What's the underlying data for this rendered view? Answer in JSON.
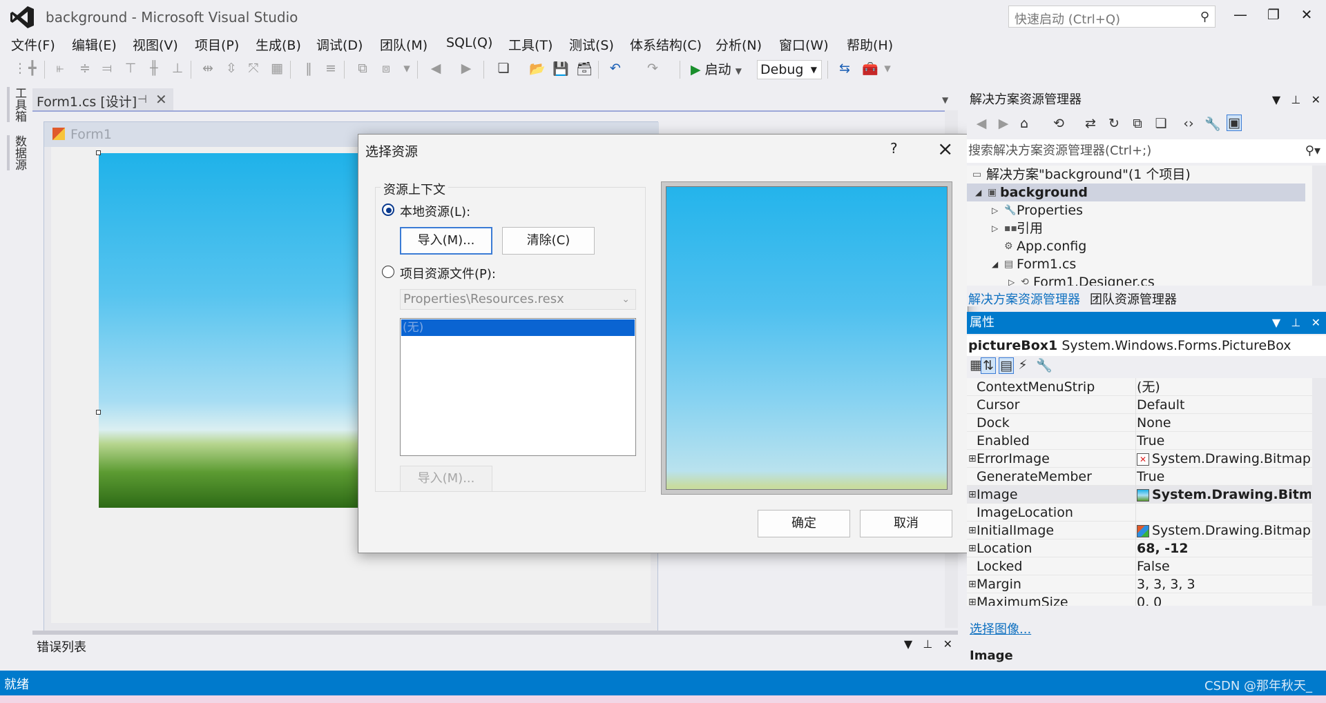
{
  "window": {
    "title": "background - Microsoft Visual Studio",
    "quick_launch_placeholder": "快速启动 (Ctrl+Q)"
  },
  "menu": [
    "文件(F)",
    "编辑(E)",
    "视图(V)",
    "项目(P)",
    "生成(B)",
    "调试(D)",
    "团队(M)",
    "SQL(Q)",
    "工具(T)",
    "测试(S)",
    "体系结构(C)",
    "分析(N)",
    "窗口(W)",
    "帮助(H)"
  ],
  "toolbar": {
    "start_label": "启动",
    "config_value": "Debug"
  },
  "side_tabs": [
    "工具箱",
    "数据源"
  ],
  "doc_tab": {
    "label": "Form1.cs [设计]"
  },
  "form": {
    "title": "Form1"
  },
  "dialog": {
    "title": "选择资源",
    "help": "?",
    "group_label": "资源上下文",
    "local_label": "本地资源(L):",
    "import_label": "导入(M)...",
    "clear_label": "清除(C)",
    "project_label": "项目资源文件(P):",
    "resx_value": "Properties\\Resources.resx",
    "list_item": "(无)",
    "import2_label": "导入(M)...",
    "ok_label": "确定",
    "cancel_label": "取消"
  },
  "solution_explorer": {
    "title": "解决方案资源管理器",
    "search_placeholder": "搜索解决方案资源管理器(Ctrl+;)",
    "tree": [
      {
        "label": "解决方案\"background\"(1 个项目)"
      },
      {
        "label": "background"
      },
      {
        "label": "Properties"
      },
      {
        "label": "引用"
      },
      {
        "label": "App.config"
      },
      {
        "label": "Form1.cs"
      },
      {
        "label": "Form1.Designer.cs"
      }
    ],
    "tabs": [
      "解决方案资源管理器",
      "团队资源管理器"
    ]
  },
  "properties": {
    "title": "属性",
    "object_name": "pictureBox1",
    "object_type": "System.Windows.Forms.PictureBox",
    "rows": [
      {
        "name": "ContextMenuStrip",
        "value": "(无)"
      },
      {
        "name": "Cursor",
        "value": "Default"
      },
      {
        "name": "Dock",
        "value": "None"
      },
      {
        "name": "Enabled",
        "value": "True"
      },
      {
        "name": "ErrorImage",
        "value": "System.Drawing.Bitmap"
      },
      {
        "name": "GenerateMember",
        "value": "True"
      },
      {
        "name": "Image",
        "value": "System.Drawing.Bitmap"
      },
      {
        "name": "ImageLocation",
        "value": ""
      },
      {
        "name": "InitialImage",
        "value": "System.Drawing.Bitmap"
      },
      {
        "name": "Location",
        "value": "68, -12"
      },
      {
        "name": "Locked",
        "value": "False"
      },
      {
        "name": "Margin",
        "value": "3, 3, 3, 3"
      },
      {
        "name": "MaximumSize",
        "value": "0, 0"
      }
    ],
    "link": "选择图像...",
    "desc_title": "Image"
  },
  "error_list": {
    "title": "错误列表"
  },
  "status": {
    "text": "就绪",
    "watermark": "CSDN @那年秋天_"
  },
  "colors": {
    "accent": "#007acc",
    "selection": "#0a64d2"
  }
}
